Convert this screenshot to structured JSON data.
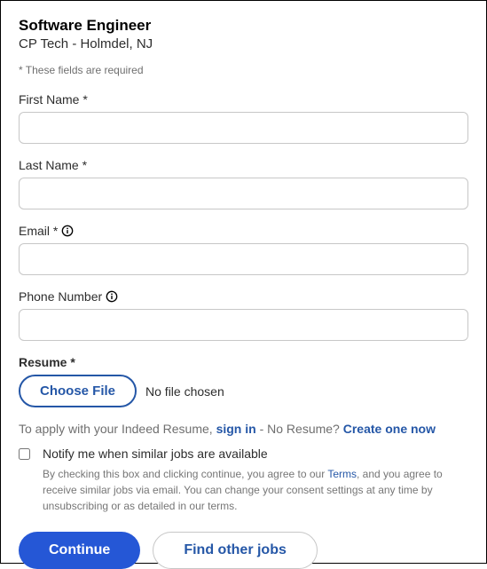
{
  "job": {
    "title": "Software Engineer",
    "company_location": "CP Tech - Holmdel, NJ"
  },
  "required_note": "* These fields are required",
  "fields": {
    "first_name": {
      "label": "First Name *",
      "value": ""
    },
    "last_name": {
      "label": "Last Name *",
      "value": ""
    },
    "email": {
      "label": "Email *",
      "value": ""
    },
    "phone": {
      "label": "Phone Number",
      "value": ""
    },
    "resume": {
      "label": "Resume *",
      "choose_file": "Choose File",
      "file_status": "No file chosen"
    }
  },
  "apply_line": {
    "prefix": "To apply with your Indeed Resume, ",
    "sign_in": "sign in",
    "middle": " - No Resume? ",
    "create": "Create one now"
  },
  "notify": {
    "label": "Notify me when similar jobs are available",
    "disclaimer_before": "By checking this box and clicking continue, you agree to our ",
    "terms": "Terms",
    "disclaimer_after": ", and you agree to receive similar jobs via email. You can change your consent settings at any time by unsubscribing or as detailed in our terms."
  },
  "buttons": {
    "continue": "Continue",
    "find_other": "Find other jobs"
  }
}
